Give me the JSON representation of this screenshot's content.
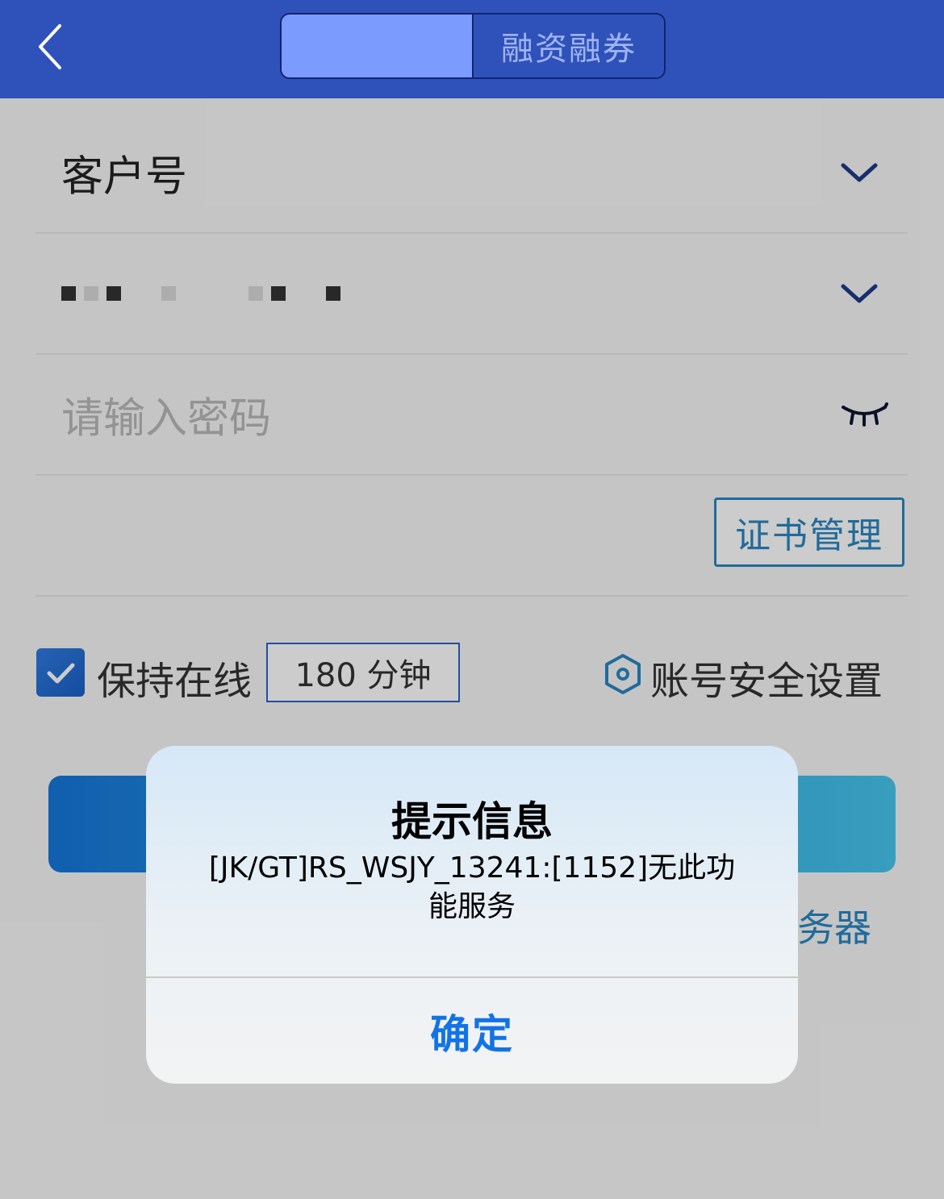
{
  "header": {
    "tabs": [
      {
        "label": "",
        "active": true
      },
      {
        "label": "融资融券",
        "active": false
      }
    ]
  },
  "form": {
    "customer_label": "客户号",
    "password_placeholder": "请输入密码",
    "cert_button": "证书管理",
    "keep_online_label": "保持在线",
    "keep_online_checked": true,
    "keep_online_duration": "180 分钟",
    "security_settings_label": "账号安全设置",
    "server_link_partial": "务器"
  },
  "dialog": {
    "title": "提示信息",
    "message": "[JK/GT]RS_WSJY_13241:[1152]无此功能服务",
    "ok_button": "确定"
  },
  "colors": {
    "header_bg": "#2f51ba",
    "accent_blue": "#2a86c2",
    "dialog_button": "#1273e6"
  }
}
